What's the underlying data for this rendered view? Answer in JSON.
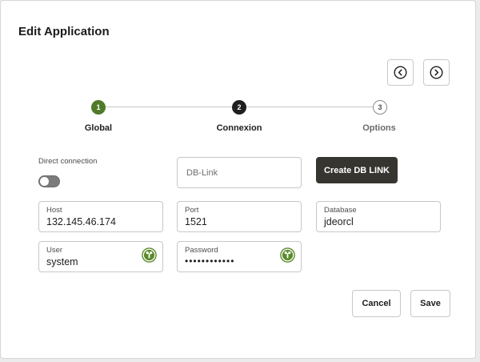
{
  "dialog": {
    "title": "Edit Application"
  },
  "steps": [
    {
      "number": "1",
      "label": "Global",
      "state": "done"
    },
    {
      "number": "2",
      "label": "Connexion",
      "state": "active"
    },
    {
      "number": "3",
      "label": "Options",
      "state": "pending"
    }
  ],
  "form": {
    "direct_connection": {
      "label": "Direct connection",
      "enabled": false
    },
    "dblink": {
      "placeholder": "DB-Link"
    },
    "create_dblink_label": "Create DB LINK",
    "host": {
      "label": "Host",
      "value": "132.145.46.174"
    },
    "port": {
      "label": "Port",
      "value": "1521"
    },
    "database": {
      "label": "Database",
      "value": "jdeorcl"
    },
    "user": {
      "label": "User",
      "value": "system"
    },
    "password": {
      "label": "Password",
      "value": "••••••••••••"
    }
  },
  "footer": {
    "cancel_label": "Cancel",
    "save_label": "Save"
  },
  "colors": {
    "step_done": "#4f7a28",
    "step_active": "#1f1f1f",
    "primary_button": "#363530",
    "key_icon": "#5a8a2b"
  },
  "icons": {
    "prev": "chevron-left-icon",
    "next": "chevron-right-icon",
    "key": "key-icon"
  }
}
